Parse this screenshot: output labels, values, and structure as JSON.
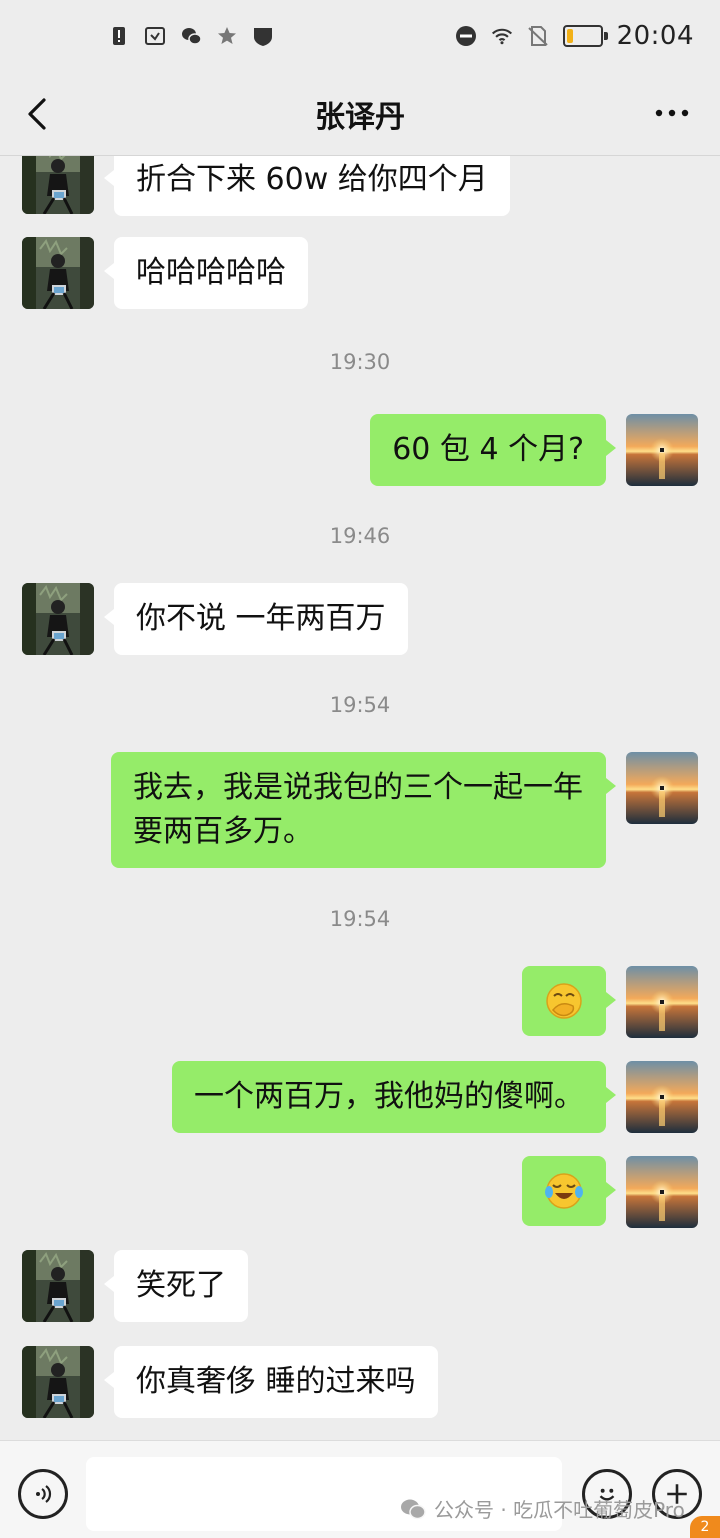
{
  "status_bar": {
    "time": "20:04",
    "left_icons": [
      "alert-icon",
      "screen-record-icon",
      "wechat-icon",
      "star-icon",
      "shield-icon"
    ],
    "right_icons": [
      "do-not-disturb-icon",
      "wifi-icon",
      "no-sim-icon",
      "battery-icon"
    ],
    "battery_level": 0.2
  },
  "header": {
    "title": "张译丹",
    "back_icon": "chevron-left-icon",
    "more_icon": "more-dots-icon"
  },
  "messages": [
    {
      "side": "in",
      "text": "折合下来 60w 给你四个月"
    },
    {
      "side": "in",
      "text": "哈哈哈哈哈"
    },
    {
      "type": "time",
      "text": "19:30"
    },
    {
      "side": "out",
      "text": "60 包 4 个月?"
    },
    {
      "type": "time",
      "text": "19:46"
    },
    {
      "side": "in",
      "text": "你不说 一年两百万"
    },
    {
      "type": "time",
      "text": "19:54"
    },
    {
      "side": "out",
      "text": "我去，我是说我包的三个一起一年要两百多万。"
    },
    {
      "type": "time",
      "text": "19:54"
    },
    {
      "side": "out",
      "emoji": "covering-mouth-laugh-emoji"
    },
    {
      "side": "out",
      "text": "一个两百万，我他妈的傻啊。"
    },
    {
      "side": "out",
      "emoji": "tears-of-joy-emoji"
    },
    {
      "side": "in",
      "text": "笑死了"
    },
    {
      "side": "in",
      "text": "你真奢侈 睡的过来吗"
    }
  ],
  "input_bar": {
    "voice_icon": "voice-icon",
    "emoji_icon": "smiley-icon",
    "plus_icon": "plus-icon"
  },
  "watermark": {
    "text": "公众号 · 吃瓜不吐葡萄皮Pro",
    "badge": "2"
  },
  "colors": {
    "background": "#ededed",
    "outgoing_bubble": "#95ec69",
    "incoming_bubble": "#ffffff",
    "timestamp": "#8a8a8a"
  }
}
